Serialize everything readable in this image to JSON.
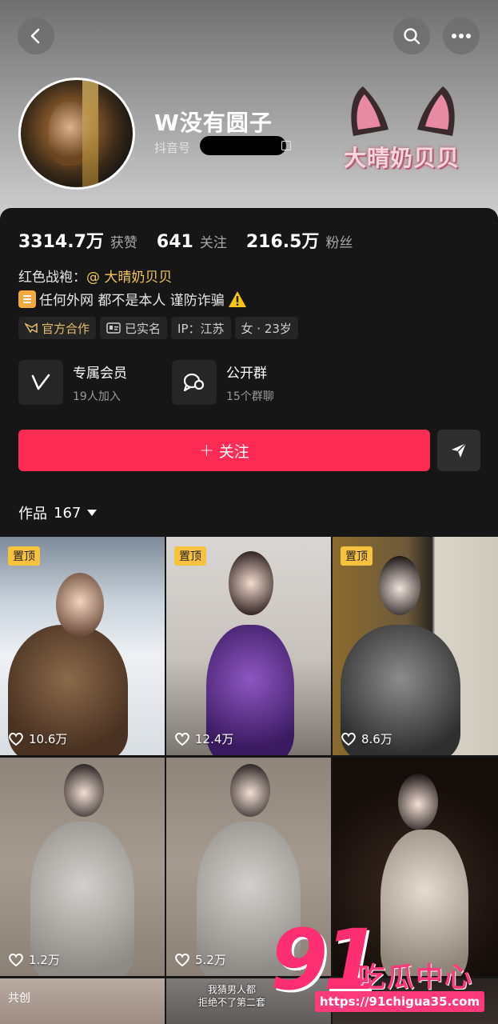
{
  "header": {
    "nickname": "W没有圆子",
    "douyin_id_label": "抖音号",
    "watermark_text": "大晴奶贝贝"
  },
  "stats": [
    {
      "value": "3314.7万",
      "label": "获赞"
    },
    {
      "value": "641",
      "label": "关注"
    },
    {
      "value": "216.5万",
      "label": "粉丝"
    }
  ],
  "bio": {
    "line1_prefix": "红色战袍：",
    "line1_mention": "@ 大晴奶贝贝",
    "line2": "任何外网 都不是本人 谨防诈骗"
  },
  "tags": [
    "官方合作",
    "已实名",
    "IP：江苏",
    "女 · 23岁"
  ],
  "features": [
    {
      "title": "专属会员",
      "sub": "19人加入",
      "icon": "v-member-icon"
    },
    {
      "title": "公开群",
      "sub": "15个群聊",
      "icon": "chat-group-icon"
    }
  ],
  "actions": {
    "follow_plus": "+",
    "follow_label": "关注"
  },
  "works": {
    "label": "作品",
    "count": "167"
  },
  "grid": {
    "pin_label": "置顶",
    "co_label": "共创",
    "likes": [
      "10.6万",
      "12.4万",
      "8.6万",
      "1.2万",
      "5.2万"
    ],
    "caption_line1": "我猜男人都",
    "caption_line2": "拒绝不了第二套"
  },
  "site_watermark": {
    "number": "91",
    "name": "吃瓜中心",
    "url": "https://91chigua35.com"
  },
  "colors": {
    "accent": "#fe2c55",
    "pin": "#f7c23e",
    "mention": "#f4c75b"
  }
}
